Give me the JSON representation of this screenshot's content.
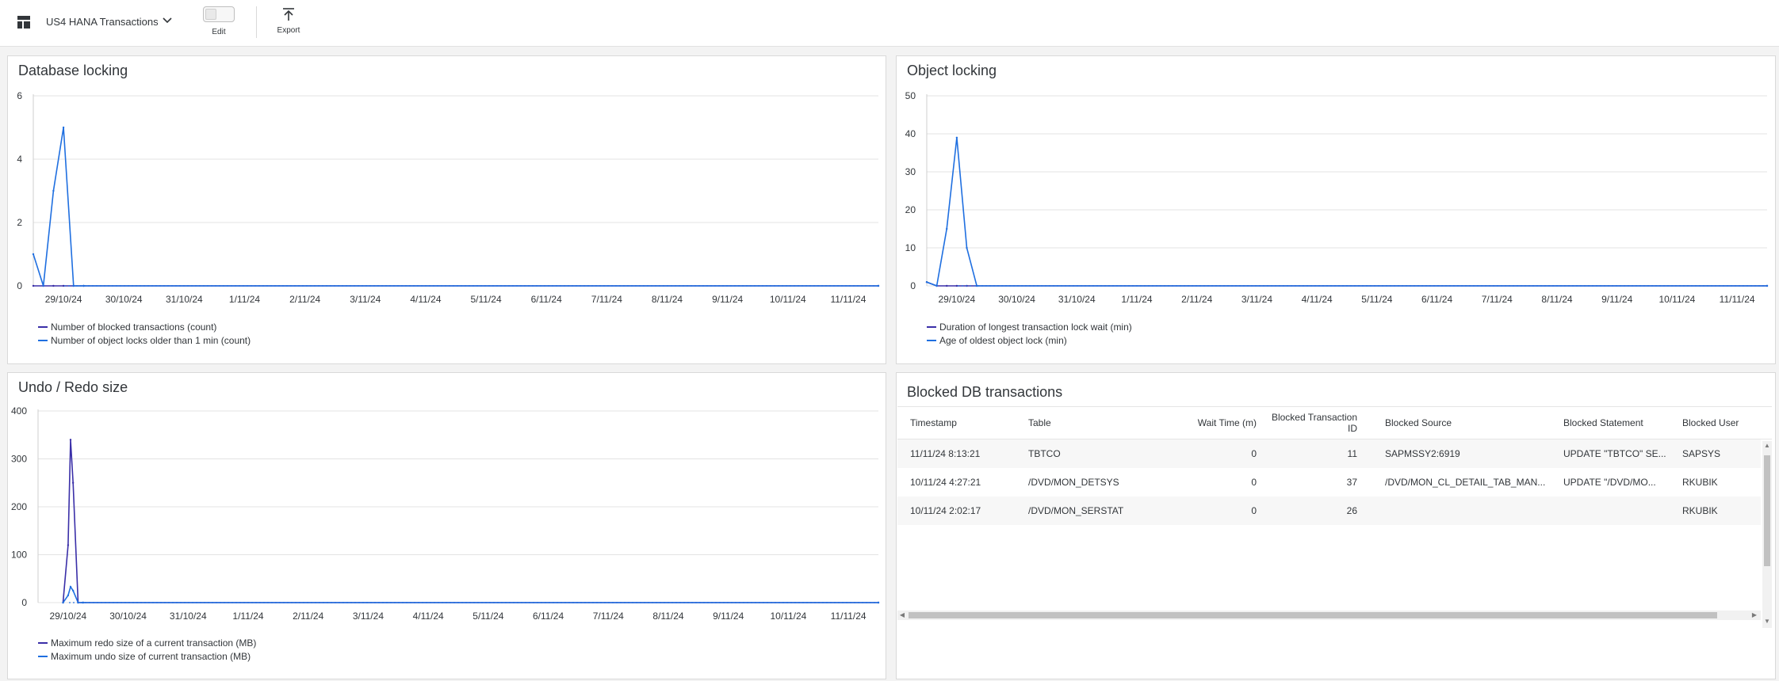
{
  "toolbar": {
    "dashboard_title": "US4 HANA Transactions",
    "edit_label": "Edit",
    "export_label": "Export"
  },
  "colors": {
    "series_dark": "#3a2fa8",
    "series_blue": "#1f6fe0",
    "grid": "#e3e3e3"
  },
  "x_labels": [
    "29/10/24",
    "30/10/24",
    "31/10/24",
    "1/11/24",
    "2/11/24",
    "3/11/24",
    "4/11/24",
    "5/11/24",
    "6/11/24",
    "7/11/24",
    "8/11/24",
    "9/11/24",
    "10/11/24",
    "11/11/24"
  ],
  "panels": {
    "db_locking": {
      "title": "Database locking",
      "legend": [
        "Number of blocked transactions (count)",
        "Number of object locks older than 1 min (count)"
      ]
    },
    "object_locking": {
      "title": "Object locking",
      "legend": [
        "Duration of longest transaction lock wait (min)",
        "Age of oldest object lock (min)"
      ]
    },
    "undo_redo": {
      "title": "Undo / Redo size",
      "legend": [
        "Maximum redo size of a current transaction (MB)",
        "Maximum undo size of current transaction (MB)"
      ]
    },
    "blocked_tx": {
      "title": "Blocked DB transactions",
      "columns": [
        "Timestamp",
        "Table",
        "Wait Time (m)",
        "Blocked Transaction ID",
        "Blocked Source",
        "Blocked Statement",
        "Blocked User"
      ],
      "rows": [
        [
          "11/11/24 8:13:21",
          "TBTCO",
          "0",
          "11",
          "SAPMSSY2:6919",
          "UPDATE \"TBTCO\" SE...",
          "SAPSYS"
        ],
        [
          "10/11/24 4:27:21",
          "/DVD/MON_DETSYS",
          "0",
          "37",
          "/DVD/MON_CL_DETAIL_TAB_MAN...",
          "UPDATE \"/DVD/MO...",
          "RKUBIK"
        ],
        [
          "10/11/24 2:02:17",
          "/DVD/MON_SERSTAT",
          "0",
          "26",
          "",
          "",
          "RKUBIK"
        ]
      ]
    }
  },
  "chart_data": [
    {
      "type": "line",
      "title": "Database locking",
      "x": [
        "28/10/24 12:00",
        "28/10/24 16:00",
        "28/10/24 20:00",
        "29/10/24 00:00",
        "29/10/24 04:00",
        "29/10/24 08:00",
        "11/11/24 12:00"
      ],
      "ylim": [
        0,
        6
      ],
      "yticks": [
        0,
        2,
        4,
        6
      ],
      "series": [
        {
          "name": "Number of blocked transactions (count)",
          "values": [
            0,
            0,
            0,
            0,
            0,
            0,
            0
          ]
        },
        {
          "name": "Number of object locks older than 1 min (count)",
          "values": [
            1,
            0,
            3,
            5,
            0,
            0,
            0
          ]
        }
      ]
    },
    {
      "type": "line",
      "title": "Object locking",
      "x": [
        "28/10/24 12:00",
        "28/10/24 16:00",
        "28/10/24 20:00",
        "29/10/24 00:00",
        "29/10/24 04:00",
        "29/10/24 08:00",
        "11/11/24 12:00"
      ],
      "ylim": [
        0,
        50
      ],
      "yticks": [
        0,
        10,
        20,
        30,
        40,
        50
      ],
      "series": [
        {
          "name": "Duration of longest transaction lock wait (min)",
          "values": [
            1,
            0,
            0,
            0,
            0,
            0,
            0
          ]
        },
        {
          "name": "Age of oldest object lock (min)",
          "values": [
            1,
            0,
            15,
            39,
            10,
            0,
            0
          ]
        }
      ]
    },
    {
      "type": "line",
      "title": "Undo / Redo size",
      "x": [
        "28/10/24 22:00",
        "29/10/24 00:00",
        "29/10/24 01:00",
        "29/10/24 02:00",
        "29/10/24 04:00",
        "29/10/24 06:00",
        "11/11/24 12:00"
      ],
      "ylim": [
        0,
        400
      ],
      "yticks": [
        0,
        100,
        200,
        300,
        400
      ],
      "series": [
        {
          "name": "Maximum redo size of a current transaction (MB)",
          "values": [
            0,
            120,
            340,
            250,
            0,
            0,
            0
          ]
        },
        {
          "name": "Maximum undo size of current transaction (MB)",
          "values": [
            0,
            15,
            33,
            25,
            0,
            0,
            0
          ]
        }
      ]
    }
  ]
}
